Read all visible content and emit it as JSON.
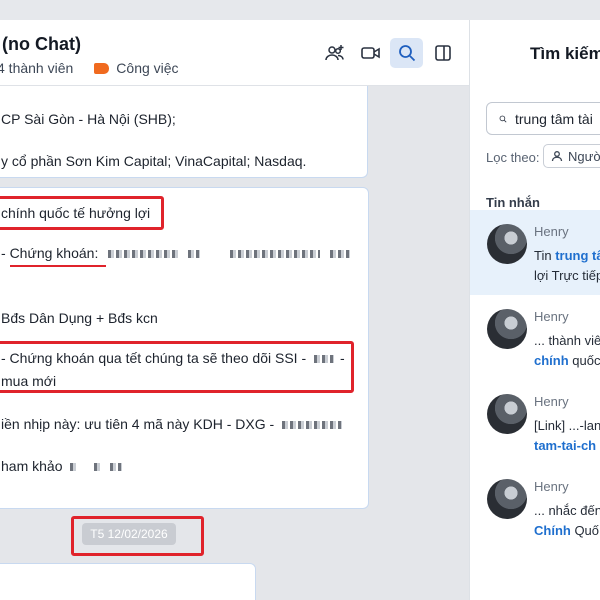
{
  "chat": {
    "title": "(no Chat)",
    "members": "4 thành viên",
    "tag": "Công việc",
    "icons": [
      "add-member-icon",
      "video-call-icon",
      "search-icon",
      "side-panel-icon"
    ]
  },
  "messages": {
    "bubble1": {
      "line1": "CP Sài Gòn - Hà Nội (SHB);",
      "line2": "y cổ phần Sơn Kim Capital; VinaCapital; Nasdaq."
    },
    "bubble2": {
      "line1": "chính quốc tế hưởng lợi",
      "line2_prefix": "-",
      "line2_label": "Chứng khoán:",
      "line3": "Bđs Dân Dụng + Bđs kcn",
      "line4": "- Chứng khoán qua tết chúng ta sẽ theo dõi SSI -",
      "line4_end": "-",
      "line5": "mua mới",
      "line6": "iền nhịp này: ưu tiên 4 mã này KDH - DXG -",
      "line7": "ham khảo"
    },
    "date_pill": "T5 12/02/2026"
  },
  "search_panel": {
    "title": "Tìm kiếm",
    "query": "trung tâm tài",
    "filter_label": "Lọc theo:",
    "filter_chip": "Người",
    "section": "Tin nhắn",
    "results": [
      {
        "name": "Henry",
        "line1_pre": "Tin ",
        "line1_hl": "trung tâ",
        "line2": "lợi Trực tiếp"
      },
      {
        "name": "Henry",
        "line1_pre": "... thành viê",
        "line1_hl": "",
        "line2_hl": "chính",
        "line2": " quốc"
      },
      {
        "name": "Henry",
        "line1_pre": "[Link] ...-lan",
        "line1_hl": "",
        "line2_hl": "tam-tai-ch",
        "line2": ""
      },
      {
        "name": "Henry",
        "line1_pre": "... nhắc đến",
        "line1_hl": "",
        "line2_hl": "Chính",
        "line2": " Quố"
      }
    ]
  }
}
